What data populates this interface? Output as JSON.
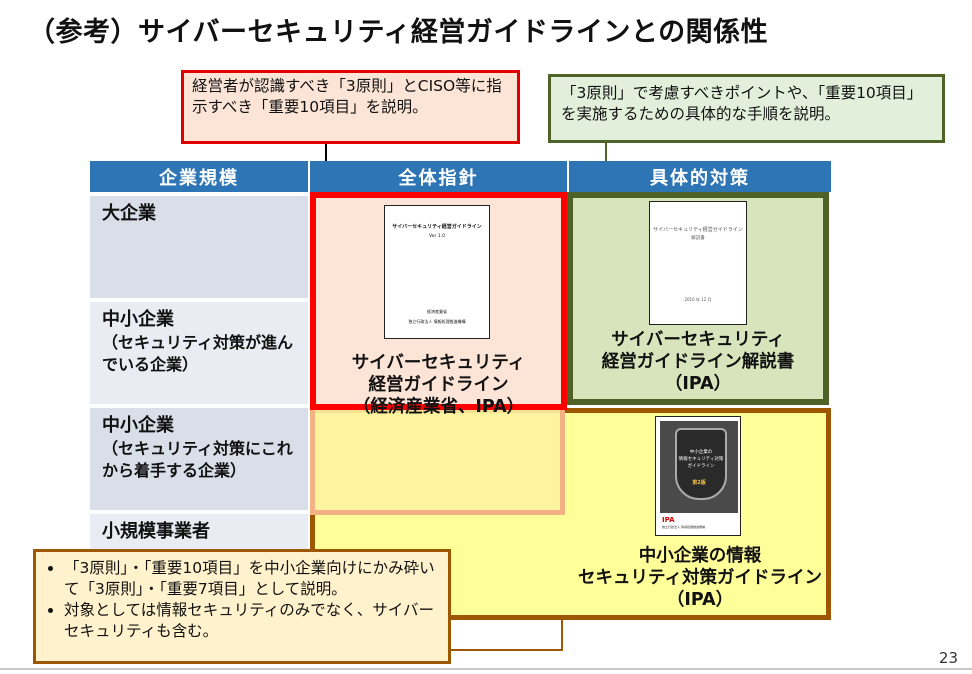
{
  "title": "（参考）サイバーセキュリティ経営ガイドラインとの関係性",
  "callouts": {
    "left": "経営者が認識すべき「3原則」とCISO等に指示すべき「重要10項目」を説明。",
    "right": "「3原則」で考慮すべきポイントや、「重要10項目」を実施するための具体的な手順を説明。",
    "bottom": [
      "「3原則」・「重要10項目」を中小企業向けにかみ砕いて「3原則」・「重要7項目」として説明。",
      "対象としては情報セキュリティのみでなく、サイバーセキュリティも含む。"
    ]
  },
  "table": {
    "headers": [
      "企業規模",
      "全体指針",
      "具体的対策"
    ],
    "rows": [
      {
        "main": "大企業",
        "sub": ""
      },
      {
        "main": "中小企業",
        "sub": "（セキュリティ対策が進んでいる企業）"
      },
      {
        "main": "中小企業",
        "sub": "（セキュリティ対策にこれから着手する企業）"
      },
      {
        "main": "小規模事業者",
        "sub": ""
      }
    ]
  },
  "documents": {
    "guideline": {
      "caption": [
        "サイバーセキュリティ",
        "経営ガイドライン",
        "（経済産業省、IPA）"
      ],
      "cover_title": "サイバーセキュリティ経営ガイドライン",
      "cover_version": "Ver 1.0",
      "cover_pub1": "経済産業省",
      "cover_pub2": "独立行政法人 情報処理推進機構"
    },
    "commentary": {
      "caption": [
        "サイバーセキュリティ",
        "経営ガイドライン解説書",
        "（IPA）"
      ],
      "cover_title": "サイバーセキュリティ経営ガイドライン",
      "cover_sub": "解説書",
      "cover_date": "2016 年 12 月"
    },
    "sme": {
      "caption": [
        "中小企業の情報",
        "セキュリティ対策ガイドライン",
        "（IPA）"
      ],
      "cover_title1": "中小企業の",
      "cover_title2": "情報セキュリティ対策",
      "cover_title3": "ガイドライン",
      "cover_edition": "第2版",
      "cover_logo": "IPA",
      "cover_pub": "独立行政法人 情報処理推進機構"
    }
  },
  "page_number": "23",
  "colors": {
    "header_blue": "#2e75b6",
    "red_border": "#ff0000",
    "green_border": "#4f6228",
    "brown_border": "#9c5700",
    "orange_border": "#f4b183",
    "yellow_fill": "#ffff99"
  }
}
